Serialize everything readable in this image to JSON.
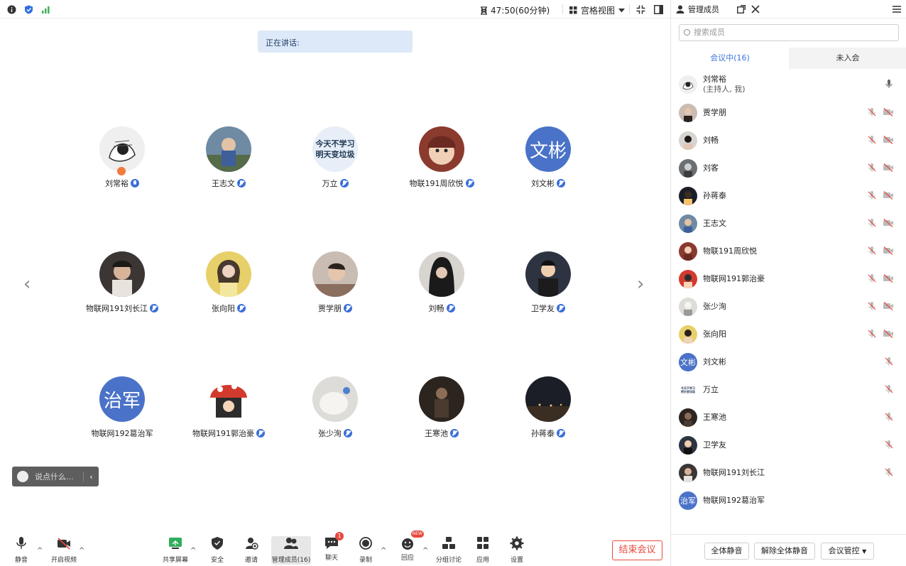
{
  "topbar": {
    "timer": "47:50(60分钟)",
    "view_mode": "宫格视图"
  },
  "speaking": {
    "label": "正在讲话:"
  },
  "grid": {
    "participants": [
      {
        "name": "刘常裕",
        "avatar": "sketch-photo",
        "muted": false,
        "host": true
      },
      {
        "name": "王志文",
        "avatar": "child-photo",
        "muted": true
      },
      {
        "name": "万立",
        "avatar_text": "今天不学习\n明天变垃圾",
        "muted": true
      },
      {
        "name": "物联191周欣悦",
        "avatar": "baby-photo",
        "muted": true
      },
      {
        "name": "刘文彬",
        "avatar_text": "文彬",
        "muted": true
      },
      {
        "name": "物联网191刘长江",
        "avatar": "man-photo",
        "muted": true
      },
      {
        "name": "张向阳",
        "avatar": "girl-photo",
        "muted": true
      },
      {
        "name": "贾学朋",
        "avatar": "boy-photo",
        "muted": true
      },
      {
        "name": "刘畅",
        "avatar": "hood-photo",
        "muted": true
      },
      {
        "name": "卫学友",
        "avatar": "cartoon-man",
        "muted": true
      },
      {
        "name": "物联网192葛治军",
        "avatar_text": "治军",
        "muted": false
      },
      {
        "name": "物联网191郭治豪",
        "avatar": "mushroom-photo",
        "muted": true
      },
      {
        "name": "张少洵",
        "avatar": "cat-photo",
        "muted": true
      },
      {
        "name": "王寒池",
        "avatar": "room-photo",
        "muted": true
      },
      {
        "name": "孙蒋泰",
        "avatar": "night-photo",
        "muted": true
      }
    ]
  },
  "chat": {
    "placeholder": "说点什么..."
  },
  "toolbar": {
    "mute": "静音",
    "video": "开启视频",
    "share": "共享屏幕",
    "security": "安全",
    "invite": "邀请",
    "members": "管理成员(16)",
    "chat": "聊天",
    "chat_badge": "1",
    "record": "录制",
    "reaction": "回应",
    "reaction_badge": "NEW",
    "breakout": "分组讨论",
    "apps": "应用",
    "settings": "设置",
    "end": "结束会议"
  },
  "panel": {
    "title": "管理成员",
    "search_placeholder": "搜索成员",
    "tab_in": "会议中(16)",
    "tab_out": "未入会",
    "members": [
      {
        "name": "刘常裕",
        "sub": "(主持人, 我)",
        "avatar": "sketch-photo",
        "mic": "on",
        "cam": "none"
      },
      {
        "name": "贾学朋",
        "avatar": "boy-photo",
        "mic": "off",
        "cam": "off"
      },
      {
        "name": "刘畅",
        "avatar": "hood-photo",
        "mic": "off",
        "cam": "off"
      },
      {
        "name": "刘客",
        "avatar": "street-photo",
        "mic": "off",
        "cam": "off"
      },
      {
        "name": "孙蒋泰",
        "avatar": "night-photo",
        "mic": "off",
        "cam": "off"
      },
      {
        "name": "王志文",
        "avatar": "child-photo",
        "mic": "off",
        "cam": "off"
      },
      {
        "name": "物联191周欣悦",
        "avatar": "baby-photo",
        "mic": "off",
        "cam": "off"
      },
      {
        "name": "物联网191郭治豪",
        "avatar": "mushroom-photo",
        "mic": "off",
        "cam": "off"
      },
      {
        "name": "张少洵",
        "avatar": "cat-photo",
        "mic": "off",
        "cam": "off"
      },
      {
        "name": "张向阳",
        "avatar": "girl-photo",
        "mic": "off",
        "cam": "off"
      },
      {
        "name": "刘文彬",
        "avatar_text": "文彬",
        "mic": "off",
        "cam": "none"
      },
      {
        "name": "万立",
        "avatar_text": "今天不学习明天变垃圾",
        "mic": "off",
        "cam": "none"
      },
      {
        "name": "王寒池",
        "avatar": "room-photo",
        "mic": "off",
        "cam": "none"
      },
      {
        "name": "卫学友",
        "avatar": "cartoon-man",
        "mic": "off",
        "cam": "none"
      },
      {
        "name": "物联网191刘长江",
        "avatar": "man-photo",
        "mic": "off",
        "cam": "none"
      },
      {
        "name": "物联网192葛治军",
        "avatar_text": "治军",
        "mic": "none",
        "cam": "none"
      }
    ],
    "btn_mute_all": "全体静音",
    "btn_unmute_all": "解除全体静音",
    "btn_control": "会议管控"
  },
  "colors": {
    "accent": "#3a76e0",
    "avatar_blue": "#4a72c8",
    "end_red": "#e8493c"
  }
}
